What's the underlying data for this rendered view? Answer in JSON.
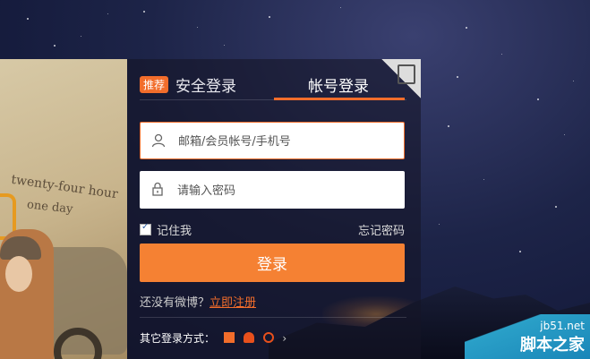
{
  "tabs": {
    "badge": "推荐",
    "safe_login": "安全登录",
    "account_login": "帐号登录"
  },
  "form": {
    "username_placeholder": "邮箱/会员帐号/手机号",
    "password_placeholder": "请输入密码",
    "remember_me": "记住我",
    "forgot_password": "忘记密码",
    "login_button": "登录"
  },
  "register": {
    "prompt": "还没有微博？",
    "link": "立即注册"
  },
  "other_login": {
    "label": "其它登录方式："
  },
  "watermark": {
    "site": "jb51.net",
    "name": "脚本之家"
  },
  "poster": {
    "text1": "twenty-four hour",
    "text2": "one day"
  },
  "colors": {
    "accent": "#f26d2b",
    "button": "#f58133"
  }
}
